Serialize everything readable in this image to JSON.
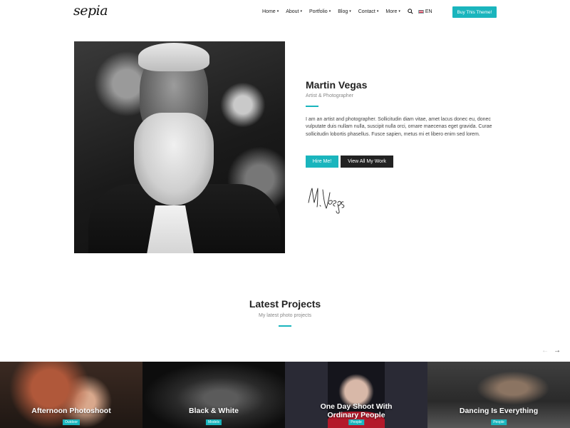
{
  "header": {
    "logo": "sepia",
    "nav": [
      {
        "label": "Home",
        "has_dropdown": true
      },
      {
        "label": "About",
        "has_dropdown": true
      },
      {
        "label": "Portfolio",
        "has_dropdown": true
      },
      {
        "label": "Blog",
        "has_dropdown": true
      },
      {
        "label": "Contact",
        "has_dropdown": true
      },
      {
        "label": "More",
        "has_dropdown": true
      }
    ],
    "search_icon": "search-icon",
    "language": "EN",
    "buy_button": "Buy This Theme!"
  },
  "profile": {
    "name": "Martin Vegas",
    "role": "Artist & Photographer",
    "bio": "I am an artist and photographer. Sollicitudin diam vitae, amet lacus donec eu, donec vulputate duis nullam nulla, suscipit nulla orci, ornare maecenas eget gravida. Curae sollicitudin lobortis phasellus. Fusce sapien, metus mi et libero enim sed lorem.",
    "hire_button": "Hire Me!",
    "work_button": "View All My Work",
    "signature": "M. Vegas"
  },
  "projects_section": {
    "title": "Latest Projects",
    "subtitle": "My latest photo projects",
    "items": [
      {
        "title": "Afternoon Photoshoot",
        "tag": "Outdoor"
      },
      {
        "title": "Black & White",
        "tag": "Models"
      },
      {
        "title": "One Day Shoot With Ordinary People",
        "tag": "People"
      },
      {
        "title": "Dancing Is Everything",
        "tag": "People"
      }
    ]
  },
  "colors": {
    "accent": "#1ab5bd",
    "dark": "#222222"
  }
}
